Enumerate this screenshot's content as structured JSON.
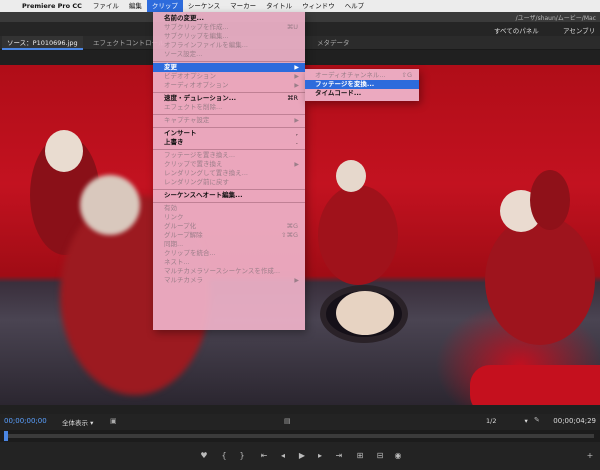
{
  "menubar": {
    "app": "Premiere Pro CC",
    "items": [
      "ファイル",
      "編集",
      "クリップ",
      "シーケンス",
      "マーカー",
      "タイトル",
      "ウィンドウ",
      "ヘルプ"
    ]
  },
  "window": {
    "path": "/ユーザ/shaun/ムービー/Mac"
  },
  "workspaces": [
    "すべてのパネル",
    "アセンブリ"
  ],
  "tabs": [
    "ソース：P1010696.jpg",
    "エフェクトコントロール",
    "メタデータ"
  ],
  "clip_menu": {
    "items": [
      {
        "label": "名前の変更...",
        "state": "bold"
      },
      {
        "label": "サブクリップを作成...",
        "state": "disabled",
        "shortcut": "⌘U"
      },
      {
        "label": "サブクリップを編集...",
        "state": "disabled"
      },
      {
        "label": "オフラインファイルを編集...",
        "state": "disabled"
      },
      {
        "label": "ソース設定...",
        "state": "disabled"
      },
      {
        "sep": true
      },
      {
        "label": "変更",
        "state": "highlight",
        "arrow": "▶"
      },
      {
        "label": "ビデオオプション",
        "state": "disabled",
        "arrow": "▶"
      },
      {
        "label": "オーディオオプション",
        "state": "disabled",
        "arrow": "▶"
      },
      {
        "sep": true
      },
      {
        "label": "速度・デュレーション...",
        "state": "bold",
        "shortcut": "⌘R"
      },
      {
        "label": "エフェクトを削除...",
        "state": "disabled"
      },
      {
        "sep": true
      },
      {
        "label": "キャプチャ設定",
        "state": "disabled",
        "arrow": "▶"
      },
      {
        "sep": true
      },
      {
        "label": "インサート",
        "state": "bold",
        "shortcut": ","
      },
      {
        "label": "上書き",
        "state": "bold",
        "shortcut": "."
      },
      {
        "sep": true
      },
      {
        "label": "フッテージを置き換え...",
        "state": "disabled"
      },
      {
        "label": "クリップで置き換え",
        "state": "disabled",
        "arrow": "▶"
      },
      {
        "label": "レンダリングして置き換え...",
        "state": "disabled"
      },
      {
        "label": "レンダリング前に戻す",
        "state": "disabled"
      },
      {
        "sep": true
      },
      {
        "label": "シーケンスへオート編集...",
        "state": "bold"
      },
      {
        "sep": true
      },
      {
        "label": "有効",
        "state": "disabled"
      },
      {
        "label": "リンク",
        "state": "disabled"
      },
      {
        "label": "グループ化",
        "state": "disabled",
        "shortcut": "⌘G"
      },
      {
        "label": "グループ解除",
        "state": "disabled",
        "shortcut": "⇧⌘G"
      },
      {
        "label": "同期...",
        "state": "disabled"
      },
      {
        "label": "クリップを統合...",
        "state": "disabled"
      },
      {
        "label": "ネスト...",
        "state": "disabled"
      },
      {
        "label": "マルチカメラソースシーケンスを作成...",
        "state": "disabled"
      },
      {
        "label": "マルチカメラ",
        "state": "disabled",
        "arrow": "▶"
      }
    ]
  },
  "modify_submenu": {
    "items": [
      {
        "label": "オーディオチャンネル...",
        "state": "disabled",
        "shortcut": "⇧G"
      },
      {
        "label": "フッテージを変換...",
        "state": "highlight"
      },
      {
        "label": "タイムコード...",
        "state": "bold"
      }
    ]
  },
  "monitor": {
    "timecode_in": "00;00;00;00",
    "timecode_out": "00;00;04;29",
    "fit": "全体表示",
    "resolution": "1/2",
    "playhead_fraction": 0.0
  }
}
